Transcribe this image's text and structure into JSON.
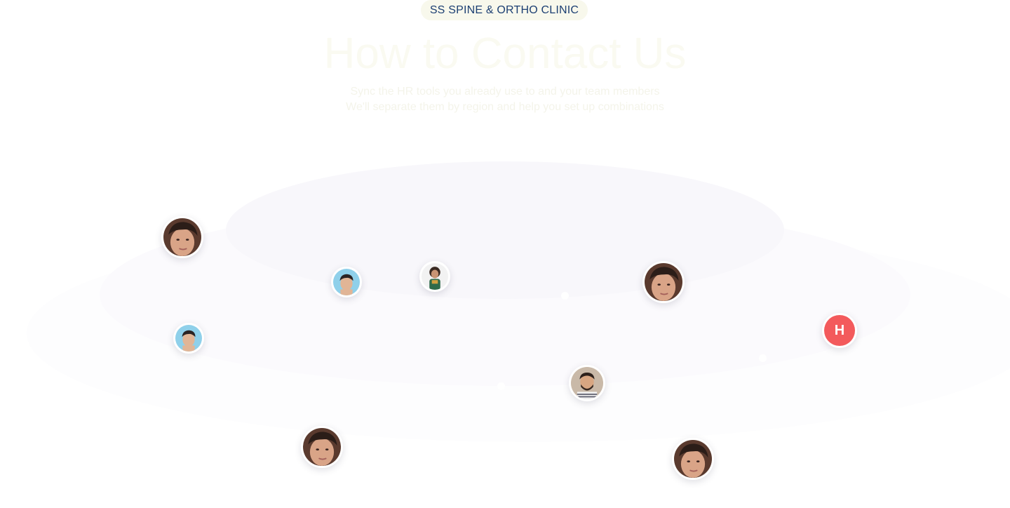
{
  "header": {
    "badge": "SS SPINE & ORTHO CLINIC",
    "title": "How to Contact Us",
    "subtitle_line1": "Sync the HR tools you already use to and your team members",
    "subtitle_line2": "We'll separate them by region and help you set up combinations"
  },
  "avatars": [
    {
      "name": "avatar-1",
      "icon": "person-photo"
    },
    {
      "name": "avatar-2",
      "icon": "person-photo"
    },
    {
      "name": "avatar-3",
      "icon": "person-photo"
    },
    {
      "name": "avatar-4",
      "icon": "person-photo"
    },
    {
      "name": "avatar-5",
      "icon": "person-photo"
    },
    {
      "name": "avatar-6",
      "icon": "person-photo"
    },
    {
      "name": "avatar-7",
      "icon": "person-photo"
    },
    {
      "name": "avatar-8",
      "icon": "person-photo"
    },
    {
      "name": "avatar-9",
      "icon": "person-photo"
    }
  ],
  "initial_avatar": {
    "letter": "H",
    "color": "#f35a5c"
  },
  "colors": {
    "badge_bg": "#f8f8ec",
    "badge_text": "#1c3f72",
    "ellipse_tint": "#f8f7fb"
  }
}
